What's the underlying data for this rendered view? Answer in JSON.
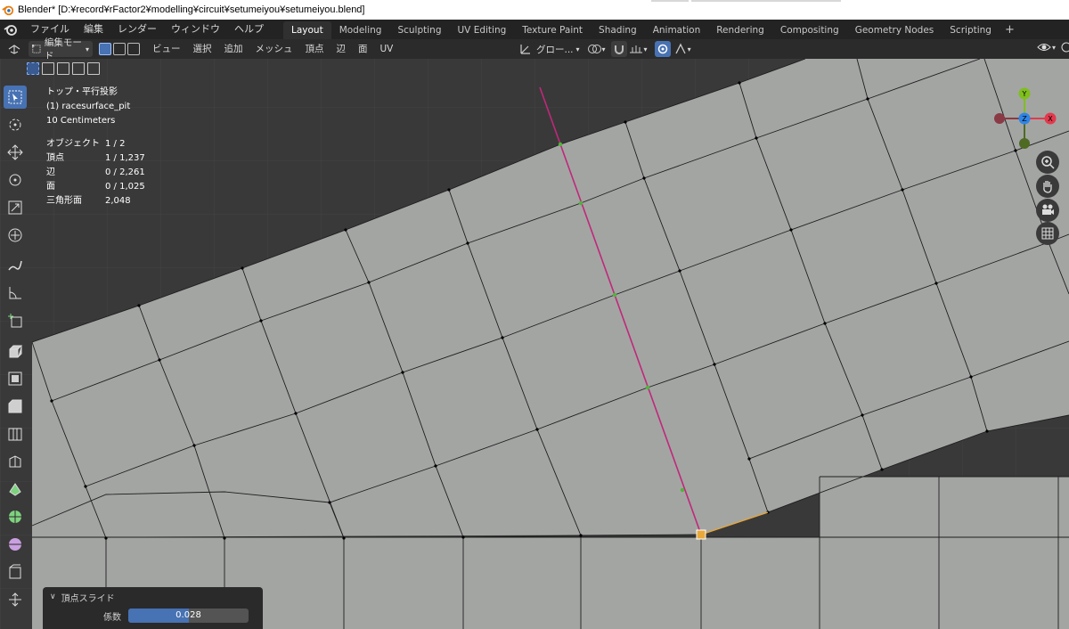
{
  "window": {
    "title": "Blender* [D:¥record¥rFactor2¥modelling¥circuit¥setumeiyou¥setumeiyou.blend]"
  },
  "menubar": {
    "items": [
      "ファイル",
      "編集",
      "レンダー",
      "ウィンドウ",
      "ヘルプ"
    ],
    "workspaces": [
      "Layout",
      "Modeling",
      "Sculpting",
      "UV Editing",
      "Texture Paint",
      "Shading",
      "Animation",
      "Rendering",
      "Compositing",
      "Geometry Nodes",
      "Scripting"
    ],
    "active_workspace": "Layout",
    "add_workspace": "+"
  },
  "header": {
    "mode": "編集モード",
    "menus": [
      "ビュー",
      "選択",
      "追加",
      "メッシュ",
      "頂点",
      "辺",
      "面",
      "UV"
    ],
    "transform_orientation": "グロー...",
    "pivot_icon": "pivot-icon",
    "snap_icon": "snap-magnet-icon",
    "proportional_icon": "proportional-edit-icon",
    "overlay_icon": "overlay-icon"
  },
  "overlay_text": {
    "view": "トップ・平行投影",
    "object": "(1) racesurface_pit",
    "scale": "10 Centimeters",
    "stats": [
      {
        "label": "オブジェクト",
        "value": "1 / 2"
      },
      {
        "label": "頂点",
        "value": "1 / 1,237"
      },
      {
        "label": "辺",
        "value": "0 / 2,261"
      },
      {
        "label": "面",
        "value": "0 / 1,025"
      },
      {
        "label": "三角形面",
        "value": "2,048"
      }
    ]
  },
  "gizmo": {
    "x_label": "X",
    "y_label": "Y",
    "z_label": "Z",
    "x_color": "#e3394d",
    "y_color": "#7fbf1e",
    "z_color": "#2f85e6"
  },
  "operator_panel": {
    "title": "頂点スライド",
    "factor_label": "係数",
    "factor_value": "0.028",
    "factor_fraction": 0.5
  },
  "colors": {
    "accent": "#4772b3",
    "mesh_face": "#a3a5a3",
    "background_grid": "#393939",
    "selected_vertex": "#e8a83a",
    "slide_edge": "#c0287a"
  },
  "toolbar": {
    "tools": [
      "select-box-icon",
      "cursor-icon",
      "move-icon",
      "rotate-icon",
      "scale-icon",
      "transform-icon",
      "annotate-icon",
      "measure-icon",
      "add-cube-icon",
      "extrude-icon",
      "inset-icon",
      "bevel-icon",
      "loop-cut-icon",
      "knife-icon",
      "poly-build-icon",
      "spin-icon",
      "smooth-icon",
      "edge-slide-icon",
      "shrink-fatten-icon",
      "shear-icon"
    ]
  }
}
